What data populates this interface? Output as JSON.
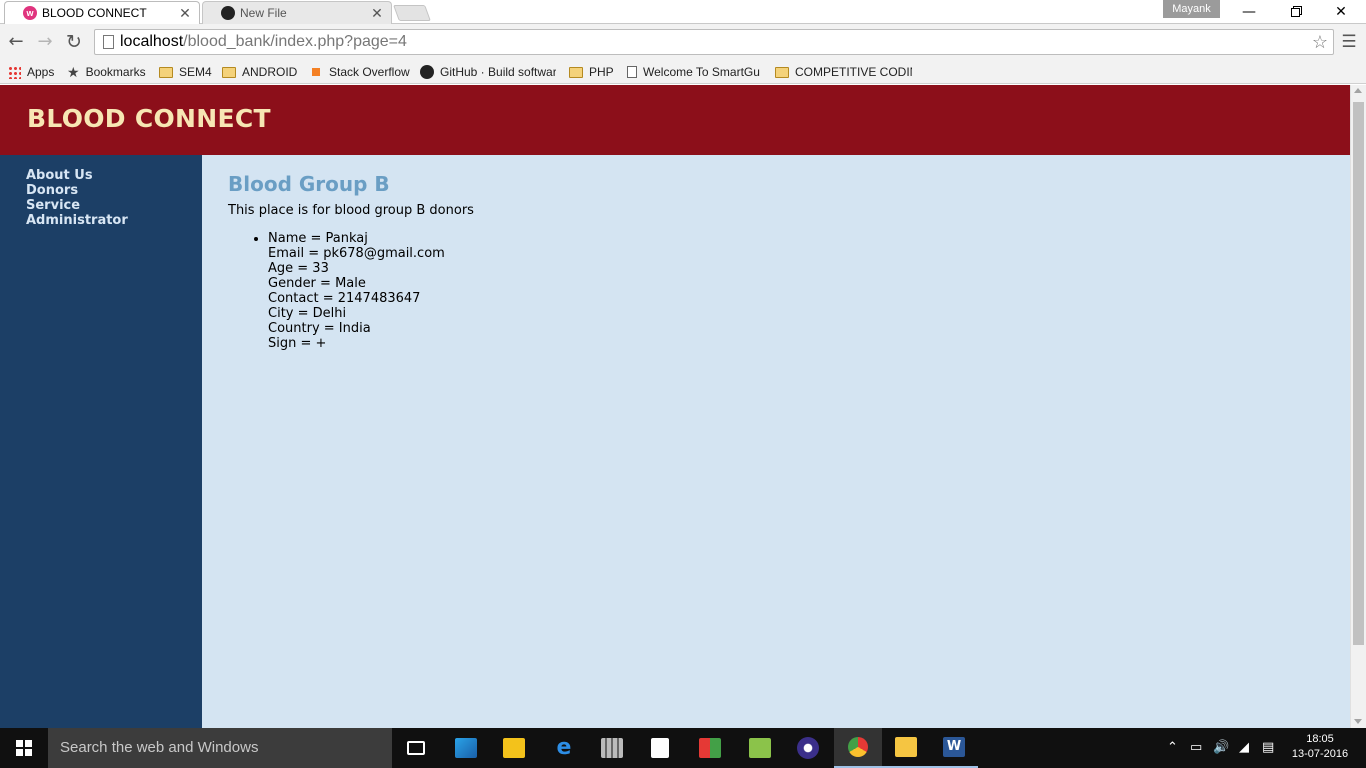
{
  "browser": {
    "tabs": [
      {
        "title": "BLOOD CONNECT",
        "favicon": "w-app-icon",
        "active": true
      },
      {
        "title": "New File",
        "favicon": "github-icon",
        "active": false
      }
    ],
    "profile_name": "Mayank",
    "url_host": "localhost",
    "url_path": "/blood_bank/index.php?page=4",
    "bookmarks": [
      {
        "label": "Apps",
        "icon": "apps-grid-icon"
      },
      {
        "label": "Bookmarks",
        "icon": "star-icon"
      },
      {
        "label": "SEM4",
        "icon": "folder-icon"
      },
      {
        "label": "ANDROID",
        "icon": "folder-icon"
      },
      {
        "label": "Stack Overflow",
        "icon": "stackoverflow-icon"
      },
      {
        "label": "GitHub · Build softwar",
        "icon": "github-icon"
      },
      {
        "label": "PHP",
        "icon": "folder-icon"
      },
      {
        "label": "Welcome To SmartGu",
        "icon": "page-icon"
      },
      {
        "label": "COMPETITIVE CODIN",
        "icon": "folder-icon"
      }
    ]
  },
  "site": {
    "title": "BLOOD CONNECT",
    "nav": [
      {
        "label": "About Us"
      },
      {
        "label": "Donors"
      },
      {
        "label": "Service"
      },
      {
        "label": "Administrator"
      }
    ],
    "heading": "Blood Group B",
    "description": "This place is for blood group B donors",
    "donor_lines": [
      "Name = Pankaj",
      "Email = pk678@gmail.com",
      "Age = 33",
      "Gender = Male",
      "Contact = 2147483647",
      "City = Delhi",
      "Country = India",
      "Sign = +"
    ],
    "colors": {
      "header_bg": "#8c0f1a",
      "title_color": "#f7e6b4",
      "sidebar_bg": "#1c3f66",
      "content_bg": "#d4e4f2",
      "heading_color": "#6a9ec4"
    }
  },
  "taskbar": {
    "search_placeholder": "Search the web and Windows",
    "time": "18:05",
    "date": "13-07-2016"
  }
}
